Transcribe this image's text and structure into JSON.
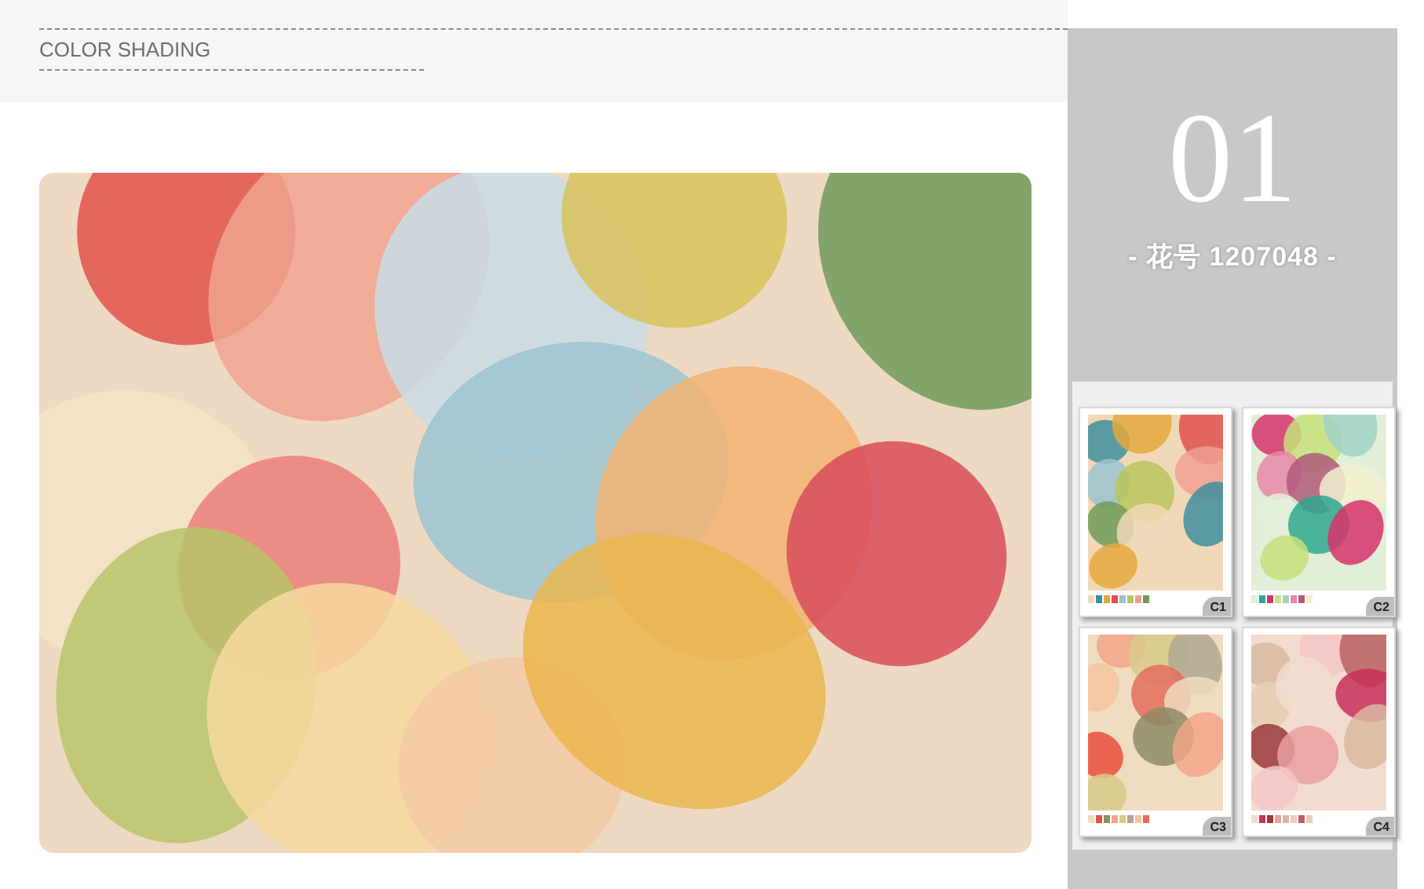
{
  "header": {
    "title": "COLOR SHADING"
  },
  "design": {
    "number": "01",
    "code": "- 花号 1207048 -"
  },
  "colorways": [
    {
      "label": "C1"
    },
    {
      "label": "C2"
    },
    {
      "label": "C3"
    },
    {
      "label": "C4"
    }
  ]
}
